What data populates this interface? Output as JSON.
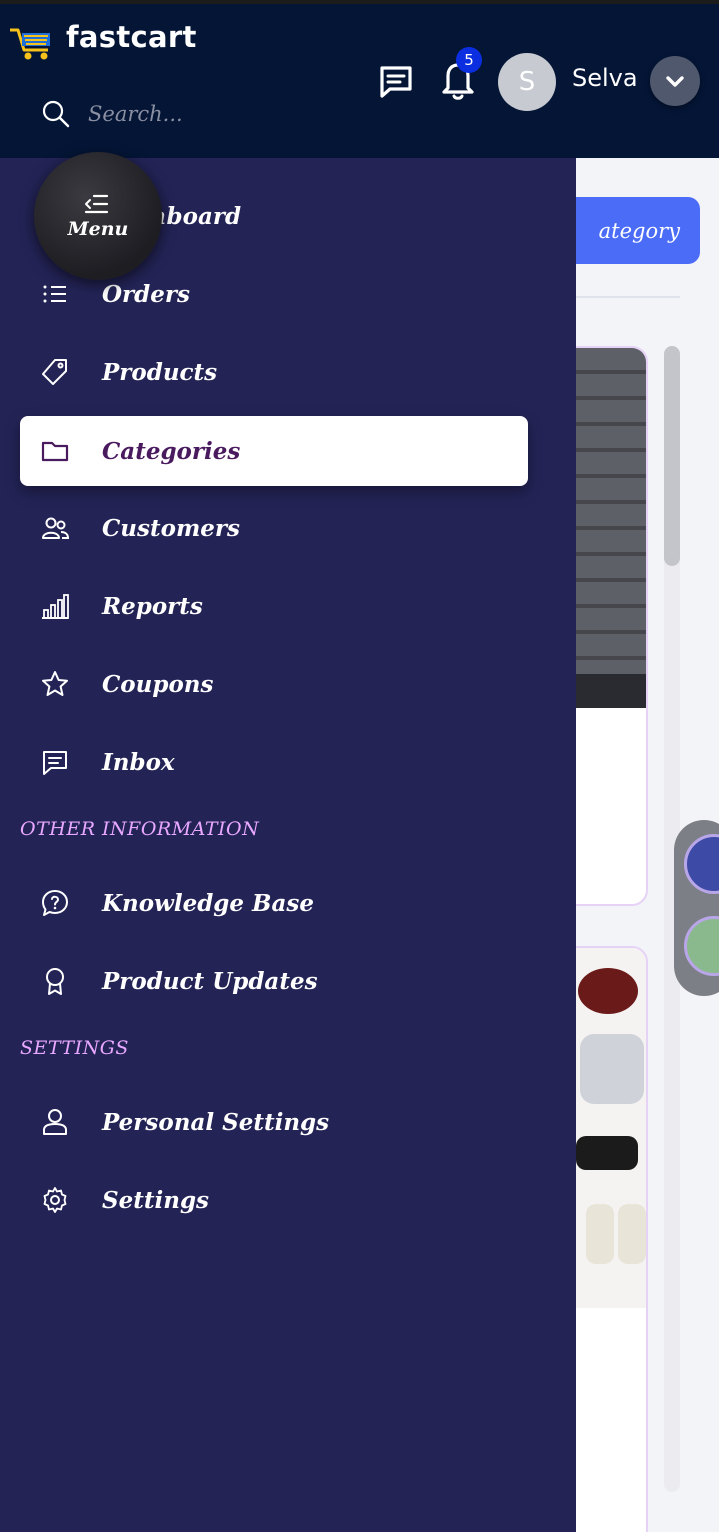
{
  "brand": {
    "name": "fastcart"
  },
  "search": {
    "placeholder": "Search..."
  },
  "header": {
    "notification_count": "5",
    "avatar_initial": "S",
    "user_name": "Selva"
  },
  "background": {
    "category_button_label": "ategory"
  },
  "menu_button": {
    "label": "Menu"
  },
  "sidebar": {
    "items": [
      {
        "label": "Dashboard",
        "icon": "home-icon"
      },
      {
        "label": "Orders",
        "icon": "list-icon"
      },
      {
        "label": "Products",
        "icon": "tag-icon"
      },
      {
        "label": "Categories",
        "icon": "folder-icon",
        "active": true
      },
      {
        "label": "Customers",
        "icon": "users-icon"
      },
      {
        "label": "Reports",
        "icon": "bar-chart-icon"
      },
      {
        "label": "Coupons",
        "icon": "star-icon"
      },
      {
        "label": "Inbox",
        "icon": "message-icon"
      }
    ],
    "sections": [
      {
        "title": "OTHER INFORMATION",
        "items": [
          {
            "label": "Knowledge Base",
            "icon": "help-chat-icon"
          },
          {
            "label": "Product Updates",
            "icon": "award-icon"
          }
        ]
      },
      {
        "title": "SETTINGS",
        "items": [
          {
            "label": "Personal Settings",
            "icon": "user-icon"
          },
          {
            "label": "Settings",
            "icon": "gear-icon"
          }
        ]
      }
    ]
  },
  "colors": {
    "header_bg": "#041536",
    "sidebar_bg": "#232356",
    "active_text": "#4a1a5e",
    "section_title": "#e9a8ff",
    "accent": "#4a6cf7",
    "badge": "#0b2fe0"
  }
}
